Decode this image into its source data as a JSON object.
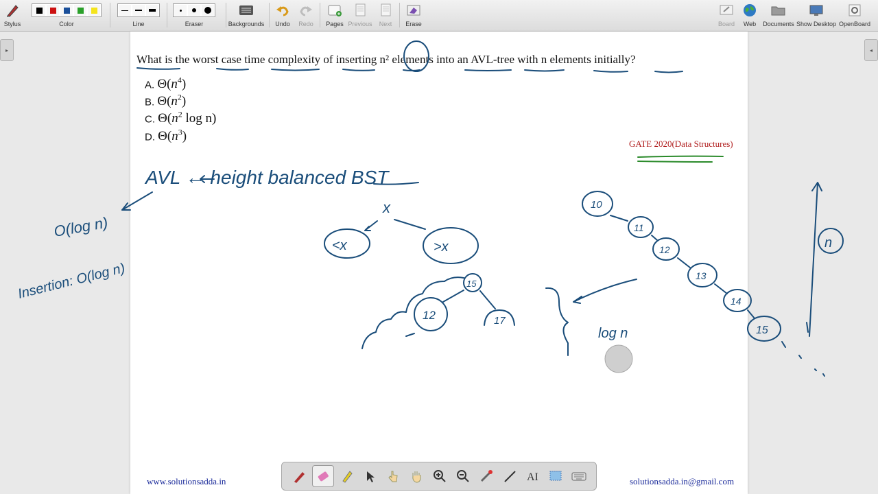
{
  "toolbar": {
    "stylus": "Stylus",
    "color": "Color",
    "line": "Line",
    "eraser": "Eraser",
    "backgrounds": "Backgrounds",
    "undo": "Undo",
    "redo": "Redo",
    "pages": "Pages",
    "previous": "Previous",
    "next": "Next",
    "erase": "Erase",
    "board": "Board",
    "web": "Web",
    "documents": "Documents",
    "show_desktop": "Show Desktop",
    "openboard": "OpenBoard",
    "colors": [
      "#000000",
      "#cc1111",
      "#1a4f9a",
      "#2aa02a",
      "#f4e41c"
    ]
  },
  "question": {
    "text": "What is the worst case time complexity of inserting n² elements into an AVL-tree with n elements initially?",
    "options": [
      {
        "label": "A.",
        "math_base": "n",
        "math_exp": "4",
        "suffix": ""
      },
      {
        "label": "B.",
        "math_base": "n",
        "math_exp": "2",
        "suffix": ""
      },
      {
        "label": "C.",
        "math_base": "n",
        "math_exp": "2",
        "suffix": " log n"
      },
      {
        "label": "D.",
        "math_base": "n",
        "math_exp": "3",
        "suffix": ""
      }
    ],
    "source": "GATE 2020(Data Structures)"
  },
  "footer": {
    "left": "www.solutionsadda.in",
    "right": "solutionsadda.in@gmail.com"
  },
  "handwriting": {
    "avl": "AVL ← height balanced BST",
    "root_x": "x",
    "left_child": "<x",
    "right_child": ">x",
    "o_logn": "O(log n)",
    "insertion": "Insertion: O(log n)",
    "node15": "15",
    "node12": "12",
    "node17": "17",
    "chain": [
      "10",
      "11",
      "12",
      "13",
      "14",
      "15"
    ],
    "logn": "log n",
    "n_label": "n"
  },
  "colors": {
    "ink": "#1a4d7a",
    "green": "#2a8a2a",
    "gate_red": "#b01c1c",
    "footer_blue": "#1a2a9a"
  }
}
